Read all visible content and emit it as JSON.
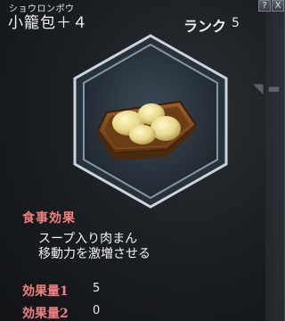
{
  "item": {
    "reading": "ショウロンポウ",
    "name": "小籠包＋４",
    "rank_label": "ランク",
    "rank_value": "5"
  },
  "window": {
    "help_label": "?",
    "close_label": "X"
  },
  "effects": {
    "title": "食事効果",
    "description_lines": [
      "スープ入り肉まん",
      "移動力を激増させる"
    ]
  },
  "stats": [
    {
      "label": "効果量1",
      "value": "5"
    },
    {
      "label": "効果量2",
      "value": "0"
    }
  ],
  "icon": {
    "name": "steamed-dumplings-in-bamboo-steamer-icon"
  },
  "colors": {
    "accent_text": "#f08080",
    "primary_text": "#f2f2f2",
    "hex_frame": "#9fb3c2"
  }
}
